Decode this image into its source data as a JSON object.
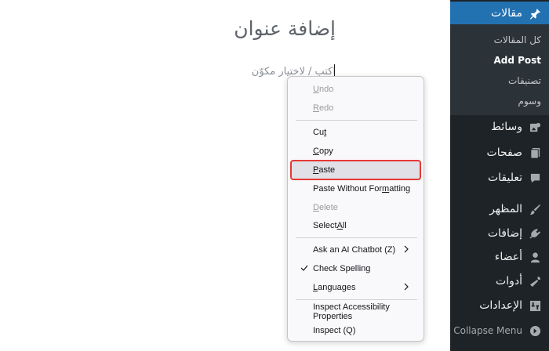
{
  "editor": {
    "title": "إضافة عنوان",
    "placeholder": "اكتب / لاختيار مكوّن"
  },
  "sidebar": {
    "items": [
      {
        "label": "مقالات",
        "icon": "pin-icon",
        "active": true
      },
      {
        "label": "وسائط",
        "icon": "media-icon"
      },
      {
        "label": "صفحات",
        "icon": "pages-icon"
      },
      {
        "label": "تعليقات",
        "icon": "comment-icon"
      },
      {
        "label": "المظهر",
        "icon": "appearance-icon"
      },
      {
        "label": "إضافات",
        "icon": "plugins-icon"
      },
      {
        "label": "أعضاء",
        "icon": "users-icon"
      },
      {
        "label": "أدوات",
        "icon": "tools-icon"
      },
      {
        "label": "الإعدادات",
        "icon": "settings-icon"
      }
    ],
    "submenu": [
      {
        "label": "كل المقالات"
      },
      {
        "label": "Add Post",
        "current": true
      },
      {
        "label": "تصنيفات"
      },
      {
        "label": "وسوم"
      }
    ],
    "collapse_label": "Collapse Menu"
  },
  "context_menu": {
    "items": [
      {
        "pre": "",
        "u": "U",
        "post": "ndo",
        "disabled": true
      },
      {
        "pre": "",
        "u": "R",
        "post": "edo",
        "disabled": true
      },
      {
        "pre": "Cu",
        "u": "t",
        "post": ""
      },
      {
        "pre": "",
        "u": "C",
        "post": "opy"
      },
      {
        "pre": "",
        "u": "P",
        "post": "aste",
        "hover": true
      },
      {
        "pre": "Paste Without For",
        "u": "m",
        "post": "atting"
      },
      {
        "pre": "",
        "u": "D",
        "post": "elete",
        "disabled": true
      },
      {
        "pre": "Select ",
        "u": "A",
        "post": "ll"
      },
      {
        "pre": "Ask an AI Chatbot (Z)",
        "u": "",
        "post": "",
        "submenu": true
      },
      {
        "pre": "Check Spelling",
        "u": "",
        "post": "",
        "checked": true
      },
      {
        "pre": "",
        "u": "L",
        "post": "anguages",
        "submenu": true
      },
      {
        "pre": "Inspect Accessibility Properties",
        "u": "",
        "post": ""
      },
      {
        "pre": "Inspect (Q)",
        "u": "",
        "post": ""
      }
    ]
  }
}
